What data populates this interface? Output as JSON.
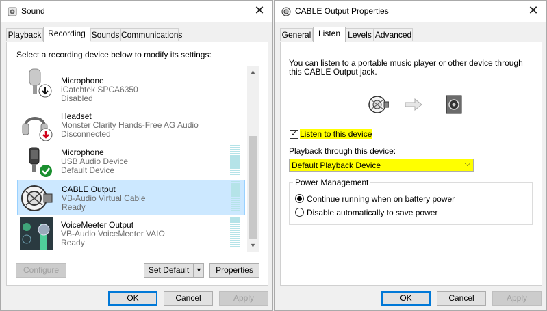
{
  "left_window": {
    "title": "Sound",
    "close_glyph": "✕",
    "tabs": [
      {
        "label": "Playback"
      },
      {
        "label": "Recording"
      },
      {
        "label": "Sounds"
      },
      {
        "label": "Communications"
      }
    ],
    "active_tab": "Recording",
    "instruction": "Select a recording device below to modify its settings:",
    "devices": [
      {
        "name": "Microphone",
        "line1": "iCatchtek SPCA6350",
        "line2": "Disabled",
        "icon": "microphone-icon",
        "status": "disabled-badge-icon"
      },
      {
        "name": "Headset",
        "line1": "Monster Clarity Hands-Free AG Audio",
        "line2": "Disconnected",
        "icon": "headset-icon",
        "status": "disconnected-badge-icon"
      },
      {
        "name": "Microphone",
        "line1": "USB Audio Device",
        "line2": "Default Device",
        "icon": "microphone-icon",
        "status": "default-check-badge-icon"
      },
      {
        "name": "CABLE Output",
        "line1": "VB-Audio Virtual Cable",
        "line2": "Ready",
        "icon": "cable-icon",
        "status": ""
      },
      {
        "name": "VoiceMeeter Output",
        "line1": "VB-Audio VoiceMeeter VAIO",
        "line2": "Ready",
        "icon": "voicemeeter-icon",
        "status": ""
      }
    ],
    "buttons": {
      "configure": "Configure",
      "set_default": "Set Default",
      "properties": "Properties",
      "ok": "OK",
      "cancel": "Cancel",
      "apply": "Apply"
    }
  },
  "right_window": {
    "title": "CABLE Output Properties",
    "close_glyph": "✕",
    "tabs": [
      {
        "label": "General"
      },
      {
        "label": "Listen"
      },
      {
        "label": "Levels"
      },
      {
        "label": "Advanced"
      }
    ],
    "active_tab": "Listen",
    "description_line1": "You can listen to a portable music player or other device through",
    "description_line2": "this CABLE Output jack.",
    "listen_checkbox_label": "Listen to this device",
    "listen_checked": true,
    "playback_label": "Playback through this device:",
    "playback_selected": "Default Playback Device",
    "power_group_title": "Power Management",
    "power_options": [
      {
        "label": "Continue running when on battery power",
        "selected": true
      },
      {
        "label": "Disable automatically to save power",
        "selected": false
      }
    ],
    "buttons": {
      "ok": "OK",
      "cancel": "Cancel",
      "apply": "Apply"
    }
  },
  "colors": {
    "selection_bg": "#cce8ff",
    "selection_border": "#99d1ff",
    "highlight": "#ffff00",
    "primary_button_border": "#0078d7",
    "level_meter": "#b5e3e8",
    "default_check": "#1a8f2e",
    "disconnected_arrow": "#d0021b"
  }
}
